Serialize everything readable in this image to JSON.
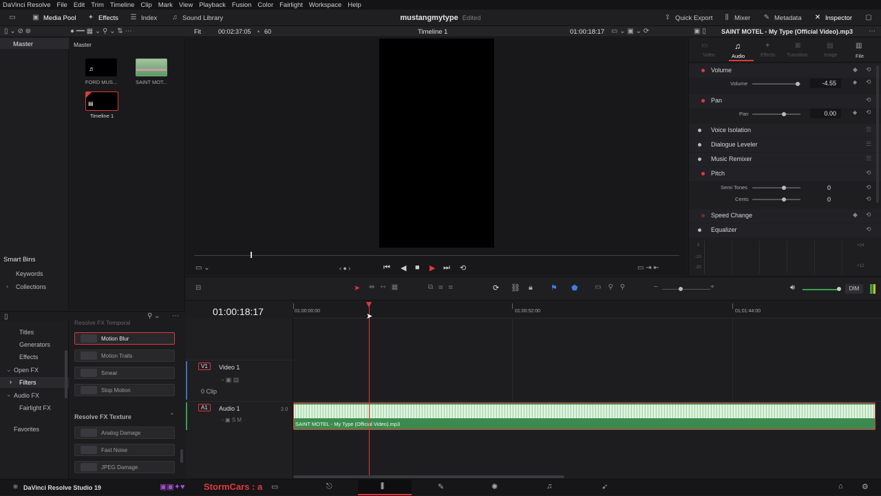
{
  "menu": [
    "DaVinci Resolve",
    "File",
    "Edit",
    "Trim",
    "Timeline",
    "Clip",
    "Mark",
    "View",
    "Playback",
    "Fusion",
    "Color",
    "Fairlight",
    "Workspace",
    "Help"
  ],
  "toolbar": {
    "media_pool": "Media Pool",
    "effects": "Effects",
    "index": "Index",
    "sound_library": "Sound Library",
    "quick_export": "Quick Export",
    "mixer": "Mixer",
    "metadata": "Metadata",
    "inspector": "Inspector"
  },
  "project": {
    "name": "mustangmytype",
    "status": "Edited"
  },
  "viewer_bar": {
    "fit": "Fit",
    "duration": "00:02:37:05",
    "fps": "60",
    "timeline_name": "Timeline 1",
    "timecode": "01:00:18:17"
  },
  "bins": {
    "master": "Master",
    "smart_bins": "Smart Bins",
    "keywords": "Keywords",
    "collections": "Collections"
  },
  "pool": {
    "title": "Master",
    "items": [
      {
        "label": "FORD MUS...",
        "kind": "audio"
      },
      {
        "label": "SAINT MOT...",
        "kind": "video"
      },
      {
        "label": "Timeline 1",
        "kind": "timeline"
      }
    ]
  },
  "inspector": {
    "clip_title": "SAINT MOTEL - My Type (Official Video).mp3",
    "tabs": [
      "Video",
      "Audio",
      "Effects",
      "Transition",
      "Image",
      "File"
    ],
    "active_tab": "Audio",
    "sections": {
      "volume": "Volume",
      "volume_label": "Volume",
      "volume_value": "-4.55",
      "pan": "Pan",
      "pan_label": "Pan",
      "pan_value": "0.00",
      "voice_isolation": "Voice Isolation",
      "dialogue_leveler": "Dialogue Leveler",
      "music_remixer": "Music Remixer",
      "pitch": "Pitch",
      "semi_tones": "Semi Tones",
      "semi_tones_value": "0",
      "cents": "Cents",
      "cents_value": "0",
      "speed_change": "Speed Change",
      "equalizer": "Equalizer"
    },
    "eq_ticks": [
      "0",
      "-10",
      "-20"
    ],
    "eq_right": [
      "+24",
      "+12"
    ]
  },
  "fx": {
    "tree": [
      "Titles",
      "Generators",
      "Effects",
      "Open FX",
      "Filters",
      "Audio FX",
      "Fairlight FX",
      "Favorites"
    ],
    "group_header": "Resolve FX Temporal",
    "temporal": [
      "Motion Blur",
      "Motion Trails",
      "Smear",
      "Stop Motion"
    ],
    "texture_header": "Resolve FX Texture",
    "texture": [
      "Analog Damage",
      "Fast Noise",
      "JPEG Damage"
    ]
  },
  "timeline": {
    "timecode": "01:00:18:17",
    "ruler": [
      "01:00:00:00",
      "01:00:52:00",
      "01:01:44:00"
    ],
    "video_track": {
      "id": "V1",
      "name": "Video 1",
      "clips": "0 Clip"
    },
    "audio_track": {
      "id": "A1",
      "name": "Audio 1",
      "channels": "2.0"
    },
    "audio_clip": "SAINT MOTEL - My Type (Official Video).mp3",
    "dim": "DIM"
  },
  "bottom": {
    "app": "DaVinci Resolve Studio 19",
    "overlay": "StormCars : a"
  },
  "colors": {
    "accent_red": "#e0393e",
    "audio_green": "#3d8a4f",
    "wave": "#d8f0d8"
  }
}
